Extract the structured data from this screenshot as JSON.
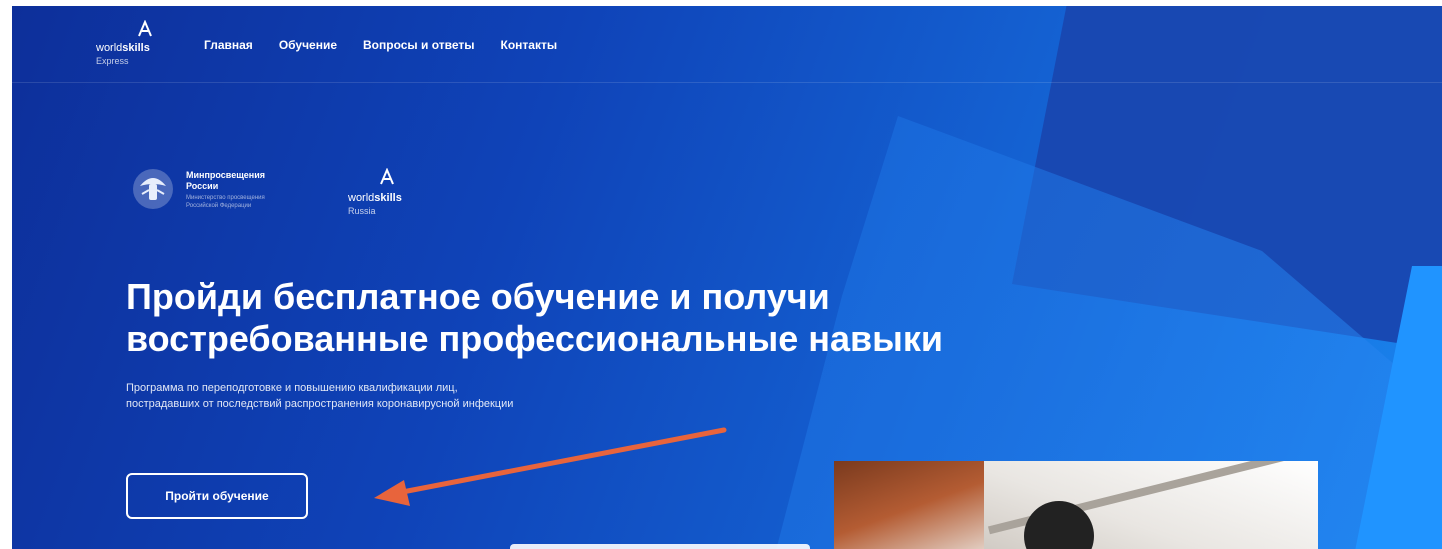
{
  "nav": {
    "logo": {
      "brand_light": "world",
      "brand_bold": "skills",
      "region": "Express"
    },
    "links": [
      "Главная",
      "Обучение",
      "Вопросы и ответы",
      "Контакты"
    ]
  },
  "partners": {
    "ministry_title": "Минпросвещения России",
    "ministry_subtitle": "Министерство просвещения Российской Федерации",
    "ws_brand_light": "world",
    "ws_brand_bold": "skills",
    "ws_region": "Russia"
  },
  "hero": {
    "headline_line1": "Пройди бесплатное обучение и получи",
    "headline_line2": "востребованные профессиональные навыки",
    "subtitle": "Программа по переподготовке и повышению квалификации лиц, пострадавших от последствий распространения коронавирусной инфекции",
    "cta_label": "Пройти обучение"
  },
  "colors": {
    "hero_start": "#0d2f9a",
    "hero_end": "#1a86ef",
    "annotation_arrow": "#e8643c"
  },
  "icons": {
    "ministry_emblem": "double-headed-eagle-icon",
    "worldskills_mark": "worldskills-logo-icon",
    "annotation": "arrow-icon"
  }
}
